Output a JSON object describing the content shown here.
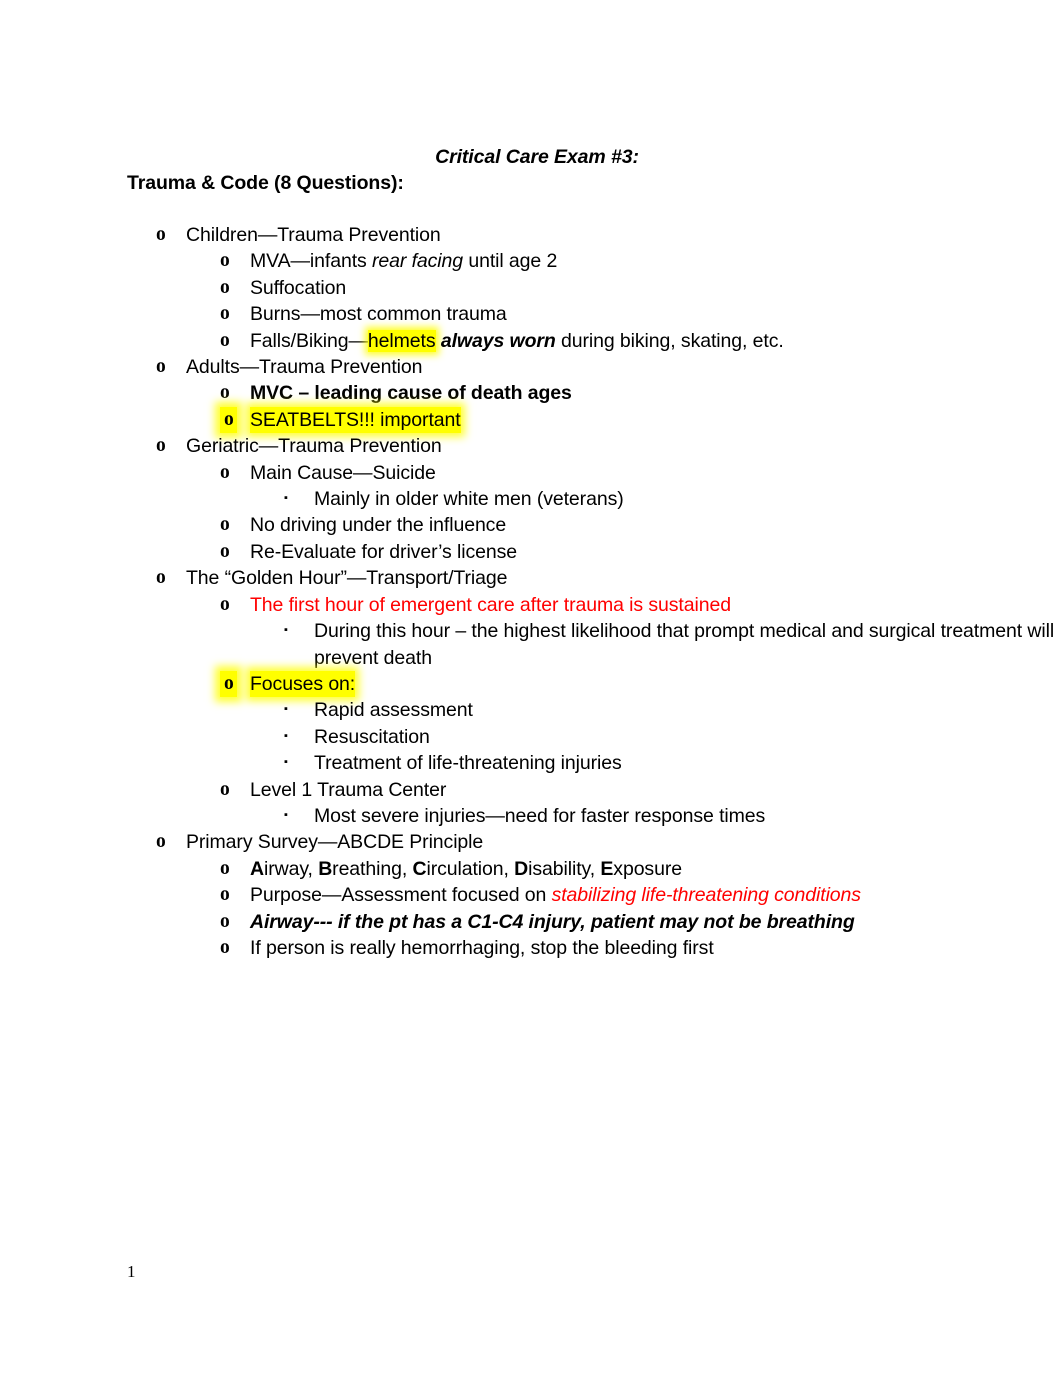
{
  "document": {
    "title": "Critical Care Exam #3:",
    "subtitle": "Trauma & Code (8 Questions):",
    "page_number": "1"
  },
  "colors": {
    "highlight": "#FFFF00",
    "emphasis_red": "#FF0000",
    "text": "#000000",
    "background": "#FFFFFF"
  },
  "bullets": {
    "level1": "o",
    "level2": "o",
    "level3": "▪"
  },
  "outline": [
    {
      "id": "children-trauma-prevention",
      "level": 1,
      "text": "Children—Trauma Prevention"
    },
    {
      "id": "mva-infants-rear-facing",
      "level": 2,
      "text_pre": "MVA—infants ",
      "text_italic": "rear facing",
      "text_post": " until age 2"
    },
    {
      "id": "suffocation",
      "level": 2,
      "text": "Suffocation"
    },
    {
      "id": "burns-most-common-trauma",
      "level": 2,
      "text": "Burns—most common trauma"
    },
    {
      "id": "falls-biking-helmets",
      "level": 2,
      "text_pre": "Falls/Biking—",
      "text_highlight": "helmets",
      "text_bolditalic": " always worn",
      "text_post": " during biking, skating, etc."
    },
    {
      "id": "adults-trauma-prevention",
      "level": 1,
      "text": "Adults—Trauma Prevention"
    },
    {
      "id": "mvc-leading-cause-of-death",
      "level": 2,
      "text": "MVC – leading cause of death ages"
    },
    {
      "id": "seatbelts-important",
      "level": 2,
      "text": "SEATBELTS!!! important"
    },
    {
      "id": "geriatric-trauma-prevention",
      "level": 1,
      "text": "Geriatric—Trauma Prevention"
    },
    {
      "id": "main-cause-suicide",
      "level": 2,
      "text": "Main Cause—Suicide"
    },
    {
      "id": "mainly-older-white-men",
      "level": 3,
      "text": "Mainly in older white men (veterans)"
    },
    {
      "id": "no-driving-under-influence",
      "level": 2,
      "text": "No driving under the influence"
    },
    {
      "id": "re-evaluate-drivers-license",
      "level": 2,
      "text": "Re-Evaluate for driver’s license"
    },
    {
      "id": "golden-hour-transport-triage",
      "level": 1,
      "text": "The “Golden Hour”—Transport/Triage"
    },
    {
      "id": "first-hour-emergent-care",
      "level": 2,
      "text": "The first hour of emergent care after trauma is sustained"
    },
    {
      "id": "during-this-hour-prevent-death",
      "level": 3,
      "text": "During this hour – the highest likelihood that prompt medical and surgical treatment will prevent death"
    },
    {
      "id": "focuses-on",
      "level": 2,
      "text": "Focuses on:"
    },
    {
      "id": "rapid-assessment",
      "level": 3,
      "text": "Rapid assessment"
    },
    {
      "id": "resuscitation",
      "level": 3,
      "text": "Resuscitation"
    },
    {
      "id": "treatment-life-threatening-injuries",
      "level": 3,
      "text": "Treatment of life-threatening injuries"
    },
    {
      "id": "level-1-trauma-center",
      "level": 2,
      "text": "Level 1 Trauma Center"
    },
    {
      "id": "most-severe-injuries",
      "level": 3,
      "text": "Most severe injuries—need for faster response times"
    },
    {
      "id": "primary-survey-abcde",
      "level": 1,
      "text": "Primary Survey—ABCDE Principle"
    },
    {
      "id": "abcde-expansion",
      "level": 2,
      "parts": [
        {
          "t": "A",
          "style": "b"
        },
        {
          "t": "irway, ",
          "style": ""
        },
        {
          "t": "B",
          "style": "b"
        },
        {
          "t": "reathing, ",
          "style": ""
        },
        {
          "t": "C",
          "style": "b"
        },
        {
          "t": "irculation, ",
          "style": ""
        },
        {
          "t": "D",
          "style": "b"
        },
        {
          "t": "isability, ",
          "style": ""
        },
        {
          "t": "E",
          "style": "b"
        },
        {
          "t": "xposure",
          "style": ""
        }
      ]
    },
    {
      "id": "purpose-assessment-focused",
      "level": 2,
      "text_pre": "Purpose—Assessment focused on ",
      "text_red_italic": "stabilizing life-threatening conditions"
    },
    {
      "id": "airway-c1-c4-injury",
      "level": 2,
      "text": "Airway--- if the pt has a C1-C4 injury, patient may not be breathing"
    },
    {
      "id": "hemorrhaging-stop-bleeding",
      "level": 2,
      "text": "If person is really hemorrhaging, stop the bleeding first"
    }
  ]
}
